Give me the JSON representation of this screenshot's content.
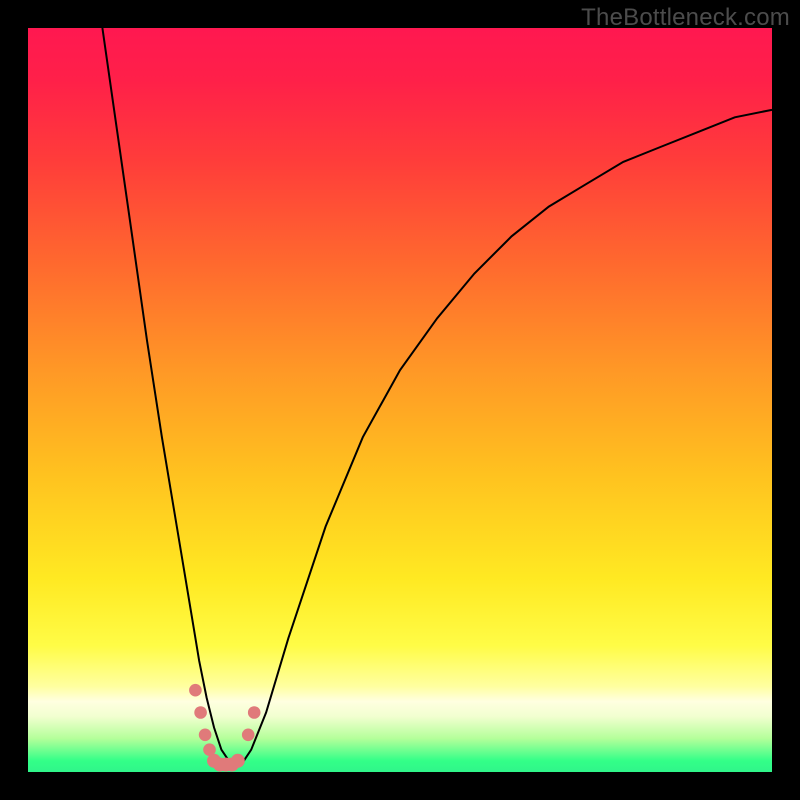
{
  "watermark": "TheBottleneck.com",
  "colors": {
    "frame": "#000000",
    "gradient_stops": [
      {
        "offset": 0.0,
        "color": "#ff1850"
      },
      {
        "offset": 0.07,
        "color": "#ff2049"
      },
      {
        "offset": 0.18,
        "color": "#ff3d3a"
      },
      {
        "offset": 0.32,
        "color": "#ff6a2e"
      },
      {
        "offset": 0.46,
        "color": "#ff9826"
      },
      {
        "offset": 0.6,
        "color": "#ffc21f"
      },
      {
        "offset": 0.74,
        "color": "#ffe922"
      },
      {
        "offset": 0.83,
        "color": "#fffc46"
      },
      {
        "offset": 0.885,
        "color": "#ffffa0"
      },
      {
        "offset": 0.905,
        "color": "#ffffe0"
      },
      {
        "offset": 0.925,
        "color": "#f2ffd0"
      },
      {
        "offset": 0.955,
        "color": "#b4ff9a"
      },
      {
        "offset": 0.985,
        "color": "#33ff88"
      },
      {
        "offset": 1.0,
        "color": "#30f58a"
      }
    ],
    "curve": "#000000",
    "marker": "#e07a7a"
  },
  "chart_data": {
    "type": "line",
    "title": "",
    "xlabel": "",
    "ylabel": "",
    "xlim": [
      0,
      100
    ],
    "ylim": [
      0,
      100
    ],
    "note": "y = bottleneck percentage (0 at bottom, 100 at top). Curve shows bottleneck vs relative component performance; minimum near x≈25–28 where bottleneck ≈0.",
    "series": [
      {
        "name": "bottleneck-curve",
        "x": [
          10,
          12,
          14,
          16,
          18,
          20,
          22,
          23,
          24,
          25,
          26,
          27,
          28,
          29,
          30,
          32,
          35,
          40,
          45,
          50,
          55,
          60,
          65,
          70,
          75,
          80,
          85,
          90,
          95,
          100
        ],
        "y": [
          100,
          86,
          72,
          58,
          45,
          33,
          21,
          15,
          10,
          6,
          3,
          1.5,
          1,
          1.5,
          3,
          8,
          18,
          33,
          45,
          54,
          61,
          67,
          72,
          76,
          79,
          82,
          84,
          86,
          88,
          89
        ]
      }
    ],
    "markers": {
      "name": "highlighted-points",
      "points": [
        {
          "x": 22.5,
          "y": 11,
          "r": 1.0
        },
        {
          "x": 23.2,
          "y": 8,
          "r": 1.0
        },
        {
          "x": 23.8,
          "y": 5,
          "r": 1.0
        },
        {
          "x": 24.4,
          "y": 3,
          "r": 1.0
        },
        {
          "x": 25.0,
          "y": 1.5,
          "r": 1.1
        },
        {
          "x": 25.8,
          "y": 1,
          "r": 1.1
        },
        {
          "x": 26.6,
          "y": 1,
          "r": 1.1
        },
        {
          "x": 27.4,
          "y": 1,
          "r": 1.1
        },
        {
          "x": 28.2,
          "y": 1.5,
          "r": 1.1
        },
        {
          "x": 29.6,
          "y": 5,
          "r": 1.0
        },
        {
          "x": 30.4,
          "y": 8,
          "r": 1.0
        }
      ]
    }
  }
}
